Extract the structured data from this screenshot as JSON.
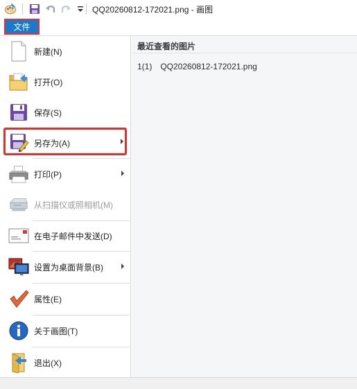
{
  "window": {
    "title": "QQ20260812-172021.png - 画图"
  },
  "quick_access": {
    "app_icon": "paint-palette-icon",
    "save_icon": "save-icon",
    "undo_icon": "undo-icon",
    "redo_icon": "redo-icon",
    "customize_icon": "chevron-down-icon"
  },
  "ribbon": {
    "file_tab_label": "文件"
  },
  "menu": {
    "items": [
      {
        "label": "新建(N)",
        "icon": "new-document-icon",
        "enabled": true,
        "submenu": false
      },
      {
        "label": "打开(O)",
        "icon": "open-folder-icon",
        "enabled": true,
        "submenu": false
      },
      {
        "label": "保存(S)",
        "icon": "save-floppy-icon",
        "enabled": true,
        "submenu": false
      },
      {
        "label": "另存为(A)",
        "icon": "save-as-icon",
        "enabled": true,
        "submenu": true
      },
      {
        "label": "打印(P)",
        "icon": "printer-icon",
        "enabled": true,
        "submenu": true
      },
      {
        "label": "从扫描仪或照相机(M)",
        "icon": "scanner-icon",
        "enabled": false,
        "submenu": false
      },
      {
        "label": "在电子邮件中发送(D)",
        "icon": "email-icon",
        "enabled": true,
        "submenu": false
      },
      {
        "label": "设置为桌面背景(B)",
        "icon": "desktop-background-icon",
        "enabled": true,
        "submenu": true
      },
      {
        "label": "属性(E)",
        "icon": "checkmark-icon",
        "enabled": true,
        "submenu": false
      },
      {
        "label": "关于画图(T)",
        "icon": "info-icon",
        "enabled": true,
        "submenu": false
      },
      {
        "label": "退出(X)",
        "icon": "exit-icon",
        "enabled": true,
        "submenu": false
      }
    ]
  },
  "recent": {
    "header": "最近查看的图片",
    "items": [
      {
        "index": "1(1)",
        "name": "QQ20260812-172021.png"
      }
    ]
  },
  "colors": {
    "file_tab": "#1979ca",
    "highlight_border": "#e0302e",
    "recent_pane_bg": "#f5f6f7"
  }
}
